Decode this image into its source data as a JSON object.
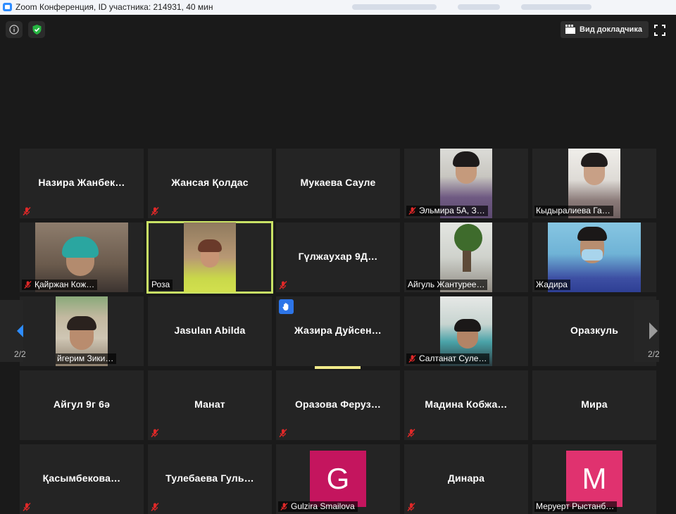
{
  "window": {
    "title": "Zoom Конференция, ID участника: 214931, 40 мин"
  },
  "toolbar": {
    "speaker_view_label": "Вид докладчика"
  },
  "pagination": {
    "left": "2/2",
    "right": "2/2"
  },
  "colors": {
    "active_border": "#c9e265",
    "raise_hand": "#2d75e8",
    "mic_muted": "#e02828",
    "avatar_g": "#c4155e",
    "avatar_m": "#e0326f"
  },
  "tiles": [
    {
      "name": "Назира  Жанбек…",
      "muted": true
    },
    {
      "name": "Жансая Қолдас",
      "muted": true
    },
    {
      "name": "Мукаева Сауле",
      "muted": false
    },
    {
      "label": "Эльмира 5А, З…",
      "muted": true,
      "video": true
    },
    {
      "label": "Кыдыралиева Га…",
      "muted": false,
      "video": true
    },
    {
      "label": "Қайржан Кож…",
      "muted": true,
      "video": true
    },
    {
      "label": "Роза",
      "muted": false,
      "video": true,
      "active": true
    },
    {
      "name": "Гүлжаухар  9Д…",
      "muted": true
    },
    {
      "label": "Айгуль Жантурее…",
      "muted": false,
      "video": true
    },
    {
      "label": "Жадира",
      "muted": false,
      "video": true
    },
    {
      "label": "йгерим Зики…",
      "muted": false,
      "video": true
    },
    {
      "name": "Jasulan Abilda",
      "muted": false
    },
    {
      "name": "Жазира  Дуйсен…",
      "muted": false,
      "raised_hand": true
    },
    {
      "label": "Салтанат Суле…",
      "muted": true,
      "video": true
    },
    {
      "name": "Оразкуль",
      "muted": false
    },
    {
      "name": "Айгул 9г 6ә",
      "muted": false
    },
    {
      "name": "Манат",
      "muted": true
    },
    {
      "name": "Оразова  Феруз…",
      "muted": true
    },
    {
      "name": "Мадина  Кобжа…",
      "muted": true
    },
    {
      "name": "Мира",
      "muted": false
    },
    {
      "name": "Қасымбекова…",
      "muted": true
    },
    {
      "name": "Тулебаева  Гуль…",
      "muted": true
    },
    {
      "avatar": "G",
      "label": "Gulzira Smailova",
      "muted": true
    },
    {
      "name": "Динара",
      "muted": true
    },
    {
      "avatar": "M",
      "label": "Меруерт Рыстанб…",
      "muted": false
    }
  ]
}
